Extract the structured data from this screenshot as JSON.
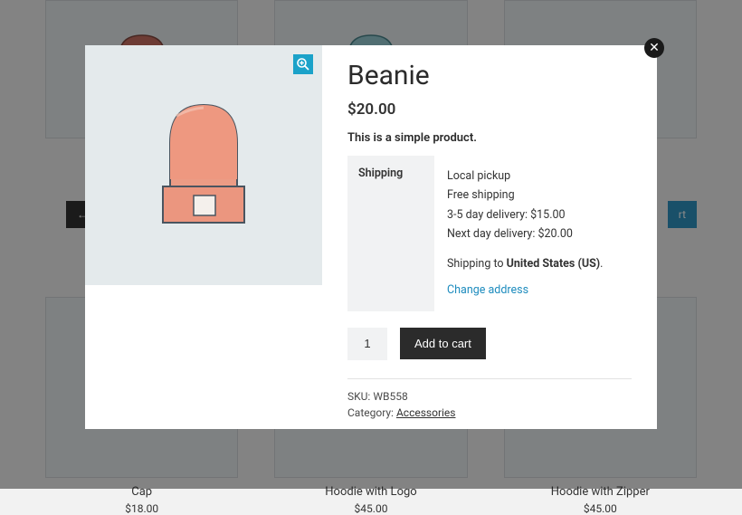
{
  "background": {
    "row2_items": [
      {
        "label": "Cap",
        "price": "$18.00"
      },
      {
        "label": "Hoodie with Logo",
        "price": "$45.00"
      },
      {
        "label": "Hoodie with Zipper",
        "price": "$45.00"
      }
    ],
    "left_btn": "←",
    "right_btn": "rt"
  },
  "modal": {
    "title": "Beanie",
    "price": "$20.00",
    "description": "This is a simple product.",
    "shipping": {
      "label": "Shipping",
      "options": [
        "Local pickup",
        "Free shipping",
        "3-5 day delivery: $15.00",
        "Next day delivery: $20.00"
      ],
      "dest_prefix": "Shipping to ",
      "dest_country": "United States (US)",
      "dest_suffix": ".",
      "change_link": "Change address"
    },
    "qty_value": "1",
    "add_to_cart": "Add to cart",
    "sku_label": "SKU: ",
    "sku_value": "WB558",
    "category_label": "Category: ",
    "category_value": "Accessories"
  }
}
